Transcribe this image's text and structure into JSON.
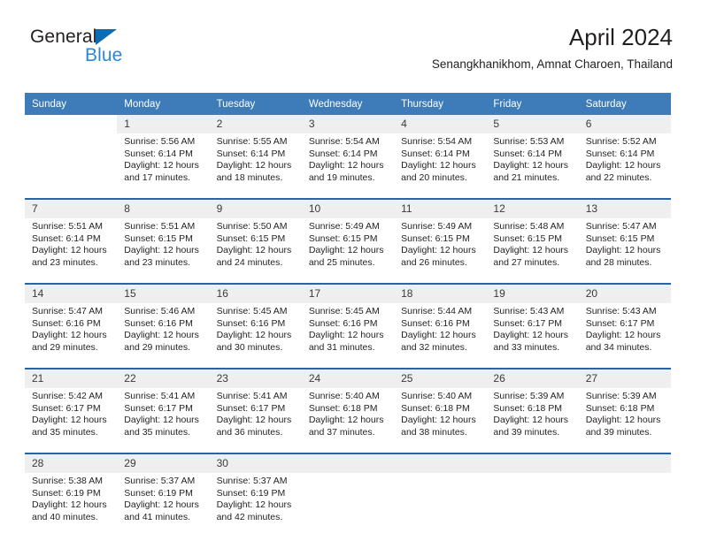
{
  "brand": {
    "name_dark": "General",
    "name_blue": "Blue",
    "accent_color": "#0b6cb3",
    "blue_text_color": "#2b87d6"
  },
  "header": {
    "title": "April 2024",
    "subtitle": "Senangkhanikhom, Amnat Charoen, Thailand"
  },
  "colors": {
    "header_row_bg": "#3d7cb8",
    "week_divider": "#2566a8",
    "daynum_bg": "#efefef",
    "text": "#231f20"
  },
  "calendar": {
    "weekday_headers": [
      "Sunday",
      "Monday",
      "Tuesday",
      "Wednesday",
      "Thursday",
      "Friday",
      "Saturday"
    ],
    "weeks": [
      [
        {
          "day": "",
          "sunrise": "",
          "sunset": "",
          "daylight_line1": "",
          "daylight_line2": "",
          "empty": true
        },
        {
          "day": "1",
          "sunrise": "Sunrise: 5:56 AM",
          "sunset": "Sunset: 6:14 PM",
          "daylight_line1": "Daylight: 12 hours",
          "daylight_line2": "and 17 minutes.",
          "empty": false
        },
        {
          "day": "2",
          "sunrise": "Sunrise: 5:55 AM",
          "sunset": "Sunset: 6:14 PM",
          "daylight_line1": "Daylight: 12 hours",
          "daylight_line2": "and 18 minutes.",
          "empty": false
        },
        {
          "day": "3",
          "sunrise": "Sunrise: 5:54 AM",
          "sunset": "Sunset: 6:14 PM",
          "daylight_line1": "Daylight: 12 hours",
          "daylight_line2": "and 19 minutes.",
          "empty": false
        },
        {
          "day": "4",
          "sunrise": "Sunrise: 5:54 AM",
          "sunset": "Sunset: 6:14 PM",
          "daylight_line1": "Daylight: 12 hours",
          "daylight_line2": "and 20 minutes.",
          "empty": false
        },
        {
          "day": "5",
          "sunrise": "Sunrise: 5:53 AM",
          "sunset": "Sunset: 6:14 PM",
          "daylight_line1": "Daylight: 12 hours",
          "daylight_line2": "and 21 minutes.",
          "empty": false
        },
        {
          "day": "6",
          "sunrise": "Sunrise: 5:52 AM",
          "sunset": "Sunset: 6:14 PM",
          "daylight_line1": "Daylight: 12 hours",
          "daylight_line2": "and 22 minutes.",
          "empty": false
        }
      ],
      [
        {
          "day": "7",
          "sunrise": "Sunrise: 5:51 AM",
          "sunset": "Sunset: 6:14 PM",
          "daylight_line1": "Daylight: 12 hours",
          "daylight_line2": "and 23 minutes.",
          "empty": false
        },
        {
          "day": "8",
          "sunrise": "Sunrise: 5:51 AM",
          "sunset": "Sunset: 6:15 PM",
          "daylight_line1": "Daylight: 12 hours",
          "daylight_line2": "and 23 minutes.",
          "empty": false
        },
        {
          "day": "9",
          "sunrise": "Sunrise: 5:50 AM",
          "sunset": "Sunset: 6:15 PM",
          "daylight_line1": "Daylight: 12 hours",
          "daylight_line2": "and 24 minutes.",
          "empty": false
        },
        {
          "day": "10",
          "sunrise": "Sunrise: 5:49 AM",
          "sunset": "Sunset: 6:15 PM",
          "daylight_line1": "Daylight: 12 hours",
          "daylight_line2": "and 25 minutes.",
          "empty": false
        },
        {
          "day": "11",
          "sunrise": "Sunrise: 5:49 AM",
          "sunset": "Sunset: 6:15 PM",
          "daylight_line1": "Daylight: 12 hours",
          "daylight_line2": "and 26 minutes.",
          "empty": false
        },
        {
          "day": "12",
          "sunrise": "Sunrise: 5:48 AM",
          "sunset": "Sunset: 6:15 PM",
          "daylight_line1": "Daylight: 12 hours",
          "daylight_line2": "and 27 minutes.",
          "empty": false
        },
        {
          "day": "13",
          "sunrise": "Sunrise: 5:47 AM",
          "sunset": "Sunset: 6:15 PM",
          "daylight_line1": "Daylight: 12 hours",
          "daylight_line2": "and 28 minutes.",
          "empty": false
        }
      ],
      [
        {
          "day": "14",
          "sunrise": "Sunrise: 5:47 AM",
          "sunset": "Sunset: 6:16 PM",
          "daylight_line1": "Daylight: 12 hours",
          "daylight_line2": "and 29 minutes.",
          "empty": false
        },
        {
          "day": "15",
          "sunrise": "Sunrise: 5:46 AM",
          "sunset": "Sunset: 6:16 PM",
          "daylight_line1": "Daylight: 12 hours",
          "daylight_line2": "and 29 minutes.",
          "empty": false
        },
        {
          "day": "16",
          "sunrise": "Sunrise: 5:45 AM",
          "sunset": "Sunset: 6:16 PM",
          "daylight_line1": "Daylight: 12 hours",
          "daylight_line2": "and 30 minutes.",
          "empty": false
        },
        {
          "day": "17",
          "sunrise": "Sunrise: 5:45 AM",
          "sunset": "Sunset: 6:16 PM",
          "daylight_line1": "Daylight: 12 hours",
          "daylight_line2": "and 31 minutes.",
          "empty": false
        },
        {
          "day": "18",
          "sunrise": "Sunrise: 5:44 AM",
          "sunset": "Sunset: 6:16 PM",
          "daylight_line1": "Daylight: 12 hours",
          "daylight_line2": "and 32 minutes.",
          "empty": false
        },
        {
          "day": "19",
          "sunrise": "Sunrise: 5:43 AM",
          "sunset": "Sunset: 6:17 PM",
          "daylight_line1": "Daylight: 12 hours",
          "daylight_line2": "and 33 minutes.",
          "empty": false
        },
        {
          "day": "20",
          "sunrise": "Sunrise: 5:43 AM",
          "sunset": "Sunset: 6:17 PM",
          "daylight_line1": "Daylight: 12 hours",
          "daylight_line2": "and 34 minutes.",
          "empty": false
        }
      ],
      [
        {
          "day": "21",
          "sunrise": "Sunrise: 5:42 AM",
          "sunset": "Sunset: 6:17 PM",
          "daylight_line1": "Daylight: 12 hours",
          "daylight_line2": "and 35 minutes.",
          "empty": false
        },
        {
          "day": "22",
          "sunrise": "Sunrise: 5:41 AM",
          "sunset": "Sunset: 6:17 PM",
          "daylight_line1": "Daylight: 12 hours",
          "daylight_line2": "and 35 minutes.",
          "empty": false
        },
        {
          "day": "23",
          "sunrise": "Sunrise: 5:41 AM",
          "sunset": "Sunset: 6:17 PM",
          "daylight_line1": "Daylight: 12 hours",
          "daylight_line2": "and 36 minutes.",
          "empty": false
        },
        {
          "day": "24",
          "sunrise": "Sunrise: 5:40 AM",
          "sunset": "Sunset: 6:18 PM",
          "daylight_line1": "Daylight: 12 hours",
          "daylight_line2": "and 37 minutes.",
          "empty": false
        },
        {
          "day": "25",
          "sunrise": "Sunrise: 5:40 AM",
          "sunset": "Sunset: 6:18 PM",
          "daylight_line1": "Daylight: 12 hours",
          "daylight_line2": "and 38 minutes.",
          "empty": false
        },
        {
          "day": "26",
          "sunrise": "Sunrise: 5:39 AM",
          "sunset": "Sunset: 6:18 PM",
          "daylight_line1": "Daylight: 12 hours",
          "daylight_line2": "and 39 minutes.",
          "empty": false
        },
        {
          "day": "27",
          "sunrise": "Sunrise: 5:39 AM",
          "sunset": "Sunset: 6:18 PM",
          "daylight_line1": "Daylight: 12 hours",
          "daylight_line2": "and 39 minutes.",
          "empty": false
        }
      ],
      [
        {
          "day": "28",
          "sunrise": "Sunrise: 5:38 AM",
          "sunset": "Sunset: 6:19 PM",
          "daylight_line1": "Daylight: 12 hours",
          "daylight_line2": "and 40 minutes.",
          "empty": false
        },
        {
          "day": "29",
          "sunrise": "Sunrise: 5:37 AM",
          "sunset": "Sunset: 6:19 PM",
          "daylight_line1": "Daylight: 12 hours",
          "daylight_line2": "and 41 minutes.",
          "empty": false
        },
        {
          "day": "30",
          "sunrise": "Sunrise: 5:37 AM",
          "sunset": "Sunset: 6:19 PM",
          "daylight_line1": "Daylight: 12 hours",
          "daylight_line2": "and 42 minutes.",
          "empty": false
        },
        {
          "day": "",
          "sunrise": "",
          "sunset": "",
          "daylight_line1": "",
          "daylight_line2": "",
          "empty": true
        },
        {
          "day": "",
          "sunrise": "",
          "sunset": "",
          "daylight_line1": "",
          "daylight_line2": "",
          "empty": true
        },
        {
          "day": "",
          "sunrise": "",
          "sunset": "",
          "daylight_line1": "",
          "daylight_line2": "",
          "empty": true
        },
        {
          "day": "",
          "sunrise": "",
          "sunset": "",
          "daylight_line1": "",
          "daylight_line2": "",
          "empty": true
        }
      ]
    ]
  }
}
